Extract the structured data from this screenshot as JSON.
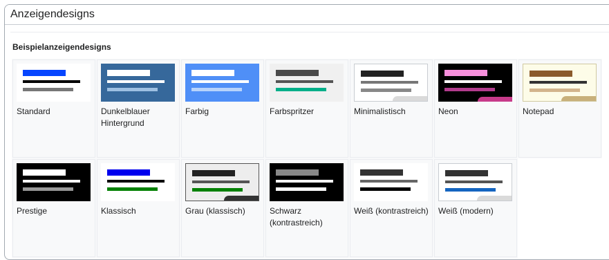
{
  "panel": {
    "title": "Anzeigendesigns"
  },
  "section": {
    "title": "Beispielanzeigendesigns"
  },
  "tiles": [
    {
      "label": "Standard",
      "bg": "#ffffff",
      "border": "",
      "b1": "#0645ff",
      "b2": "#000000",
      "b3": "#777777",
      "corner": ""
    },
    {
      "label": "Dunkelblauer Hintergrund",
      "bg": "#36689b",
      "border": "",
      "b1": "#ffffff",
      "b2": "#ffffff",
      "b3": "#9ec0e2",
      "corner": ""
    },
    {
      "label": "Farbig",
      "bg": "#4f8ff7",
      "border": "",
      "b1": "#ffffff",
      "b2": "#ffffff",
      "b3": "#b8d3fb",
      "corner": ""
    },
    {
      "label": "Farbspritzer",
      "bg": "#f0f0f0",
      "border": "",
      "b1": "#4a4a4a",
      "b2": "#555555",
      "b3": "#00af89",
      "corner": ""
    },
    {
      "label": "Minimalistisch",
      "bg": "#ffffff",
      "border": "#c8ccd1",
      "b1": "#222222",
      "b2": "#777777",
      "b3": "#888888",
      "corner": "#dadada"
    },
    {
      "label": "Neon",
      "bg": "#000000",
      "border": "",
      "b1": "#f78fdc",
      "b2": "#ffffff",
      "b3": "#b13b8d",
      "corner": "#c73a8a"
    },
    {
      "label": "Notepad",
      "bg": "#fdfce8",
      "border": "#d0c9a0",
      "b1": "#8b5a2b",
      "b2": "#333333",
      "b3": "#d2b48c",
      "corner": "#c8b07a"
    },
    {
      "label": "Prestige",
      "bg": "#000000",
      "border": "",
      "b1": "#ffffff",
      "b2": "#ffffff",
      "b3": "#999999",
      "corner": ""
    },
    {
      "label": "Klassisch",
      "bg": "#ffffff",
      "border": "",
      "b1": "#0000ee",
      "b2": "#000000",
      "b3": "#008000",
      "corner": ""
    },
    {
      "label": "Grau (klassisch)",
      "bg": "#ededed",
      "border": "#555555",
      "b1": "#222222",
      "b2": "#555555",
      "b3": "#008000",
      "corner": "#333333"
    },
    {
      "label": "Schwarz (kontrastreich)",
      "bg": "#000000",
      "border": "",
      "b1": "#888888",
      "b2": "#ffffff",
      "b3": "#ffffff",
      "corner": ""
    },
    {
      "label": "Weiß (kontrastreich)",
      "bg": "#ffffff",
      "border": "",
      "b1": "#333333",
      "b2": "#666666",
      "b3": "#000000",
      "corner": ""
    },
    {
      "label": "Weiß (modern)",
      "bg": "#ffffff",
      "border": "#c8ccd1",
      "b1": "#333333",
      "b2": "#555555",
      "b3": "#1565c0",
      "corner": "#dadada"
    }
  ]
}
